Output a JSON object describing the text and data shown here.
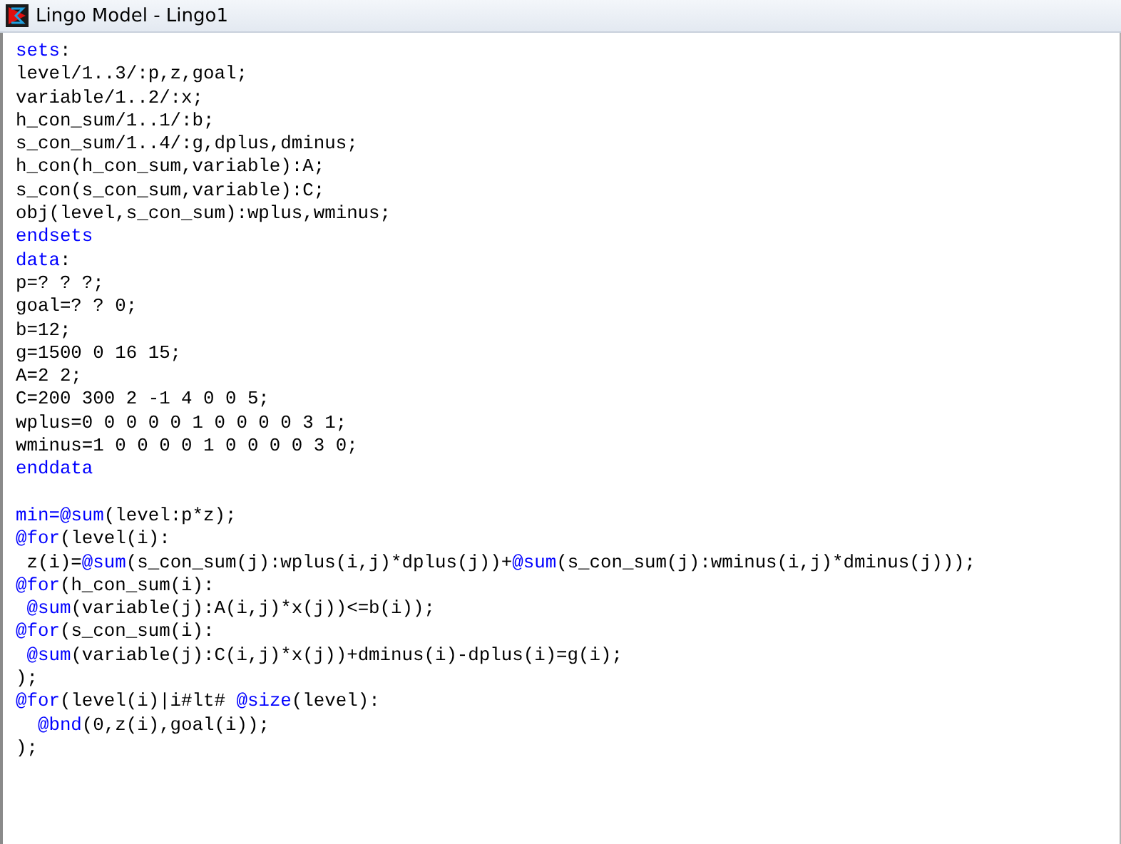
{
  "window": {
    "title": "Lingo Model - Lingo1"
  },
  "editor": {
    "blocks": [
      [
        [
          {
            "text": "sets",
            "kind": "keyword"
          },
          {
            "text": ":",
            "kind": "plain"
          }
        ],
        [
          {
            "text": "level/1..3/:p,z,goal;",
            "kind": "plain"
          }
        ],
        [
          {
            "text": "variable/1..2/:x;",
            "kind": "plain"
          }
        ],
        [
          {
            "text": "h_con_sum/1..1/:b;",
            "kind": "plain"
          }
        ],
        [
          {
            "text": "s_con_sum/1..4/:g,dplus,dminus;",
            "kind": "plain"
          }
        ],
        [
          {
            "text": "h_con(h_con_sum,variable):A;",
            "kind": "plain"
          }
        ],
        [
          {
            "text": "s_con(s_con_sum,variable):C;",
            "kind": "plain"
          }
        ],
        [
          {
            "text": "obj(level,s_con_sum):wplus,wminus;",
            "kind": "plain"
          }
        ],
        [
          {
            "text": "endsets",
            "kind": "keyword"
          }
        ],
        [
          {
            "text": "data",
            "kind": "keyword"
          },
          {
            "text": ":",
            "kind": "plain"
          }
        ],
        [
          {
            "text": "p=? ? ?;",
            "kind": "plain"
          }
        ],
        [
          {
            "text": "goal=? ? 0;",
            "kind": "plain"
          }
        ],
        [
          {
            "text": "b=12;",
            "kind": "plain"
          }
        ],
        [
          {
            "text": "g=1500 0 16 15;",
            "kind": "plain"
          }
        ],
        [
          {
            "text": "A=2 2;",
            "kind": "plain"
          }
        ],
        [
          {
            "text": "C=200 300 2 -1 4 0 0 5;",
            "kind": "plain"
          }
        ],
        [
          {
            "text": "wplus=0 0 0 0 0 1 0 0 0 0 3 1;",
            "kind": "plain"
          }
        ],
        [
          {
            "text": "wminus=1 0 0 0 0 1 0 0 0 0 3 0;",
            "kind": "plain"
          }
        ],
        [
          {
            "text": "enddata",
            "kind": "keyword"
          }
        ]
      ],
      [
        [
          {
            "text": "min=",
            "kind": "keyword"
          },
          {
            "text": "@sum",
            "kind": "keyword"
          },
          {
            "text": "(level:p*z);",
            "kind": "plain"
          }
        ],
        [
          {
            "text": "@for",
            "kind": "keyword"
          },
          {
            "text": "(level(i):",
            "kind": "plain"
          }
        ],
        [
          {
            "text": " z(i)=",
            "kind": "plain"
          },
          {
            "text": "@sum",
            "kind": "keyword"
          },
          {
            "text": "(s_con_sum(j):wplus(i,j)*dplus(j))+",
            "kind": "plain"
          },
          {
            "text": "@sum",
            "kind": "keyword"
          },
          {
            "text": "(s_con_sum(j):wminus(i,j)*dminus(j)));",
            "kind": "plain"
          }
        ],
        [
          {
            "text": "@for",
            "kind": "keyword"
          },
          {
            "text": "(h_con_sum(i):",
            "kind": "plain"
          }
        ],
        [
          {
            "text": " @sum",
            "kind": "keyword"
          },
          {
            "text": "(variable(j):A(i,j)*x(j))<=b(i));",
            "kind": "plain"
          }
        ],
        [
          {
            "text": "@for",
            "kind": "keyword"
          },
          {
            "text": "(s_con_sum(i):",
            "kind": "plain"
          }
        ],
        [
          {
            "text": " @sum",
            "kind": "keyword"
          },
          {
            "text": "(variable(j):C(i,j)*x(j))+dminus(i)-dplus(i)=g(i);",
            "kind": "plain"
          }
        ],
        [
          {
            "text": ");",
            "kind": "plain"
          }
        ],
        [
          {
            "text": "@for",
            "kind": "keyword"
          },
          {
            "text": "(level(i)|i#lt# ",
            "kind": "plain"
          },
          {
            "text": "@size",
            "kind": "keyword"
          },
          {
            "text": "(level):",
            "kind": "plain"
          }
        ],
        [
          {
            "text": "  @bnd",
            "kind": "keyword"
          },
          {
            "text": "(0,z(i),goal(i));",
            "kind": "plain"
          }
        ],
        [
          {
            "text": ");",
            "kind": "plain"
          }
        ]
      ]
    ]
  }
}
